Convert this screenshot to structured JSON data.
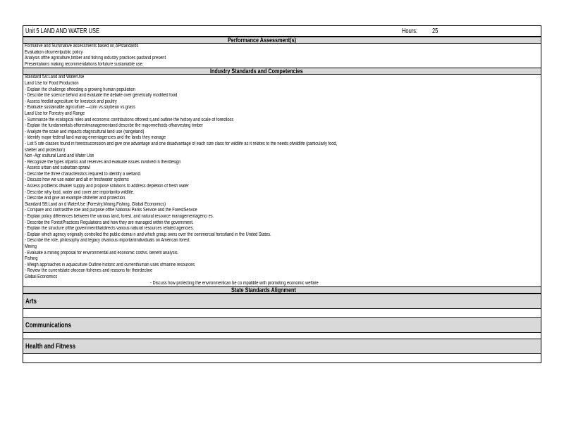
{
  "header": {
    "unit_label": "Unit 5 LAND AND WATER USE",
    "hours_label": "Hours:",
    "hours_value": "25"
  },
  "performance": {
    "title": "Performance Assessment(s)",
    "lines": [
      "Formative and Summative assessments based on APstandards",
      "Evaluation ofcurrentpublic policy",
      "Analysis ofthe agriculture,timber and fishing industry practices pastand present",
      "Presentations making recommendations forfuture sustainable use."
    ]
  },
  "industry": {
    "title": "Industry Standards and Competencies",
    "lines": [
      "Standard 5A:Land and WaterUse",
      "Land Use for Food Production",
      "- Explain the challenge offeeding a growing human population",
      "- Describe the science behind and evaluate the debate over genetically modified food",
      "- Assess feedlot agriculture for livestock and poultry",
      "- Evaluate sustainable agriculture —corn vs.soybean vs.grass",
      "Land Use for Forestry and Range",
      "- Summarize the ecological roles and economic contributions offorest s,and outline the history and scale of forestloss",
      "- Explain the fundamentals offorestmanagementand describe the majormethods ofharvesting timber",
      "- Analyze the scale and impacts ofagricultural land use (rangeland)",
      "- Identify major federal land manag ementagencies and the lands they manage",
      "- List 5 site classes found in forestsuccession and give one advantage and one disadvantage of each size class for wildlife as it relates to the needs ofwildlife (particularly food,",
      "shelter and protection)",
      "Non -Agr icultural Land and Water Use",
      "- Recognize the types ofparks and reserves and evaluate issues involved in theirdesign",
      "- Assess urban and suburban sprawl",
      "- Describe the three characteristics required to identify a wetland.",
      "- Discuss how we use water and alt er freshwater systems",
      "- Assess problems ofwater supply and propose solutions to address depletion of fresh water",
      "- Describe why food, water and cover are importantto wildlife.",
      "- Describe and give an example ofshelter and protection.",
      "Standard 5B:Land an d WaterUse (Forestry,Mining,Fishing, Global Economics)",
      "- Compare and contrastthe role and purpose ofthe National Parks Service and the ForestService",
      "- Explain policy differences between the various land, forest, and natural resource managementagenci es.",
      "- Describe the ForestPractices Regulations and how they are managed within the government.",
      "- Explain the structure ofthe governmentthatdirects various natural resources related agencies.",
      "- Explain which agency originally controlled the public domai n and which group owns over the commercial forestland in the United States.",
      "- Describe the role, philosophy and legacy ofvarious importantindividuals on American forest.",
      "Mining",
      "- Evaluate a mining proposal for environmental and economic costvs. benefit analysis.",
      "Fishing",
      "- Weigh approaches in aquaculture Outline historic and currenthuman uses ofmarine resources",
      "- Review the currentstate ofocean fisheries and reasons for theirdecline",
      "Global Economics",
      "- Discuss how protecting the environmentcan be co mpatible with promoting economic welfare"
    ]
  },
  "state": {
    "title": "State Standards Alignment"
  },
  "sections": [
    "Arts",
    "Communications",
    "Health and Fitness"
  ]
}
